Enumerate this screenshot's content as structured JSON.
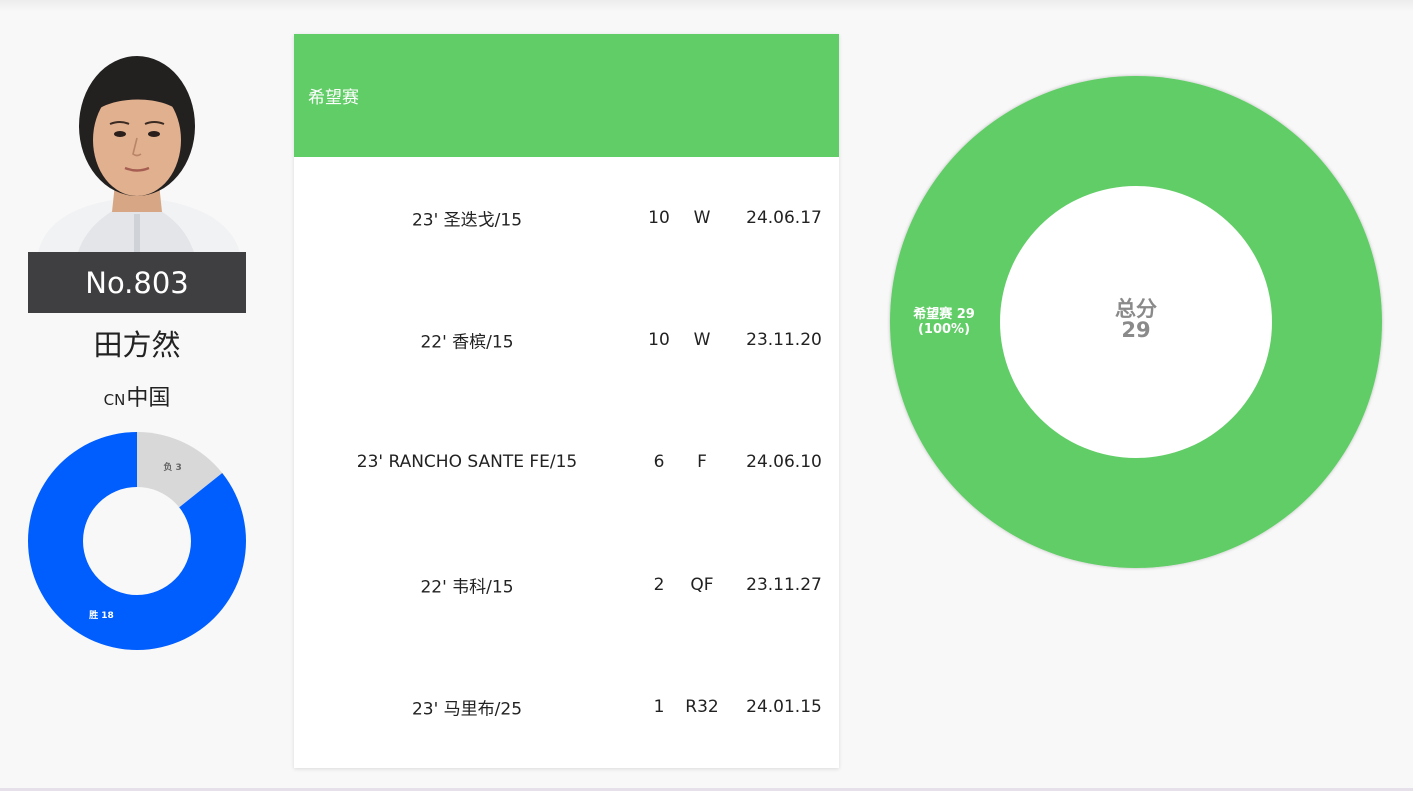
{
  "player": {
    "rank": "No.803",
    "name": "田方然",
    "country_code": "CN",
    "country_name": "中国"
  },
  "win_loss_chart": {
    "type": "pie",
    "slices": [
      {
        "label": "胜 18",
        "value": 18,
        "color": "#005efe"
      },
      {
        "label": "负 3",
        "value": 3,
        "color": "#d8d8d8"
      }
    ]
  },
  "table": {
    "header_title": "希望赛",
    "rows": [
      {
        "event": "23' 圣迭戈/15",
        "points": "10",
        "round": "W",
        "date": "24.06.17"
      },
      {
        "event": "22' 香槟/15",
        "points": "10",
        "round": "W",
        "date": "23.11.20"
      },
      {
        "event": "23' RANCHO SANTE FE/15",
        "points": "6",
        "round": "F",
        "date": "24.06.10"
      },
      {
        "event": "22' 韦科/15",
        "points": "2",
        "round": "QF",
        "date": "23.11.27"
      },
      {
        "event": "23' 马里布/25",
        "points": "1",
        "round": "R32",
        "date": "24.01.15"
      }
    ]
  },
  "chart_data": {
    "type": "pie",
    "categories": [
      "希望赛"
    ],
    "values": [
      29
    ],
    "slice_labels": [
      "希望赛 29",
      "(100%)"
    ],
    "center_title": "总分",
    "center_value": "29",
    "colors": [
      "#60cd66"
    ]
  }
}
